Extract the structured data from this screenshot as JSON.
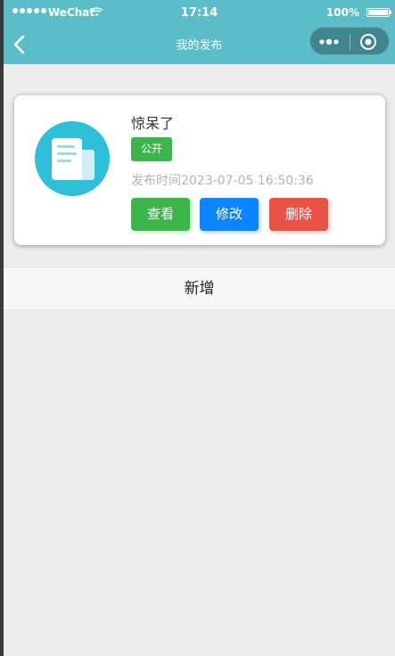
{
  "status_bar": {
    "carrier": "WeChat",
    "time": "17:14",
    "battery": "100%"
  },
  "nav": {
    "title": "我的发布"
  },
  "card": {
    "title": "惊呆了",
    "tag": "公开",
    "publish_time": "发布时间2023-07-05 16:50:36",
    "buttons": {
      "view": "查看",
      "edit": "修改",
      "delete": "删除"
    }
  },
  "add_label": "新增",
  "colors": {
    "nav_bg": "#5bbdc8",
    "avatar_bg": "#2ebfd9",
    "green": "#3cb64b",
    "blue": "#0a84ff",
    "red": "#e95247"
  },
  "icons": [
    "signal-icon",
    "wifi-icon",
    "battery-icon",
    "back-icon",
    "more-icon",
    "close-miniprogram-icon",
    "document-icon"
  ]
}
